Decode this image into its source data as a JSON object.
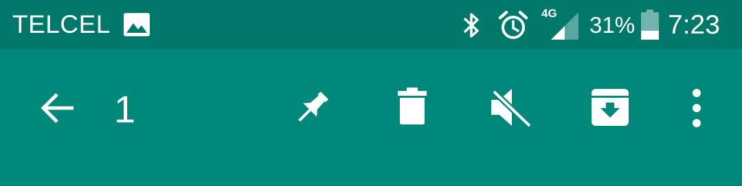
{
  "status_bar": {
    "carrier": "TELCEL",
    "network_type": "4G",
    "battery_percent": "31%",
    "time": "7:23",
    "icons": [
      "image-icon",
      "bluetooth-icon",
      "alarm-icon",
      "signal-icon",
      "battery-icon"
    ]
  },
  "action_bar": {
    "selected_count": "1",
    "buttons": [
      "back-arrow-icon",
      "pin-icon",
      "delete-icon",
      "mute-icon",
      "archive-icon",
      "more-vert-icon"
    ]
  },
  "colors": {
    "status_bar": "#00796B",
    "action_bar": "#00897B",
    "foreground": "#FFFFFF"
  }
}
